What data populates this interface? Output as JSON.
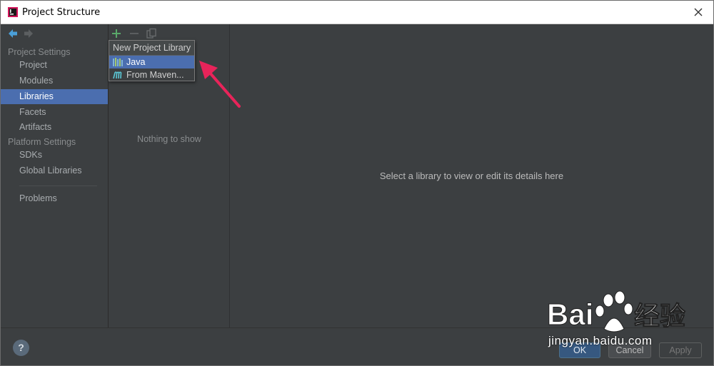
{
  "window": {
    "title": "Project Structure"
  },
  "nav": {
    "project_settings_header": "Project Settings",
    "project_items": [
      "Project",
      "Modules",
      "Libraries",
      "Facets",
      "Artifacts"
    ],
    "platform_settings_header": "Platform Settings",
    "platform_items": [
      "SDKs",
      "Global Libraries"
    ],
    "problems": "Problems",
    "selected": "Libraries"
  },
  "libraries": {
    "empty_text": "Nothing to show",
    "toolbar": {
      "add_icon": "plus-icon",
      "remove_icon": "minus-icon",
      "copy_icon": "copy-icon"
    }
  },
  "popup": {
    "title": "New Project Library",
    "items": [
      {
        "label": "Java",
        "icon": "java-library-icon",
        "selected": true
      },
      {
        "label": "From Maven...",
        "icon": "maven-icon",
        "selected": false
      }
    ]
  },
  "details": {
    "placeholder": "Select a library to view or edit its details here"
  },
  "buttons": {
    "help": "?",
    "ok": "OK",
    "cancel": "Cancel",
    "apply": "Apply"
  },
  "watermark": {
    "brand": "Bai",
    "brand_suffix": "经验",
    "domain": "jingyan.baidu.com"
  },
  "colors": {
    "selection": "#4b6eaf",
    "accent_arrow": "#e8245a",
    "add_green": "#59a869"
  }
}
